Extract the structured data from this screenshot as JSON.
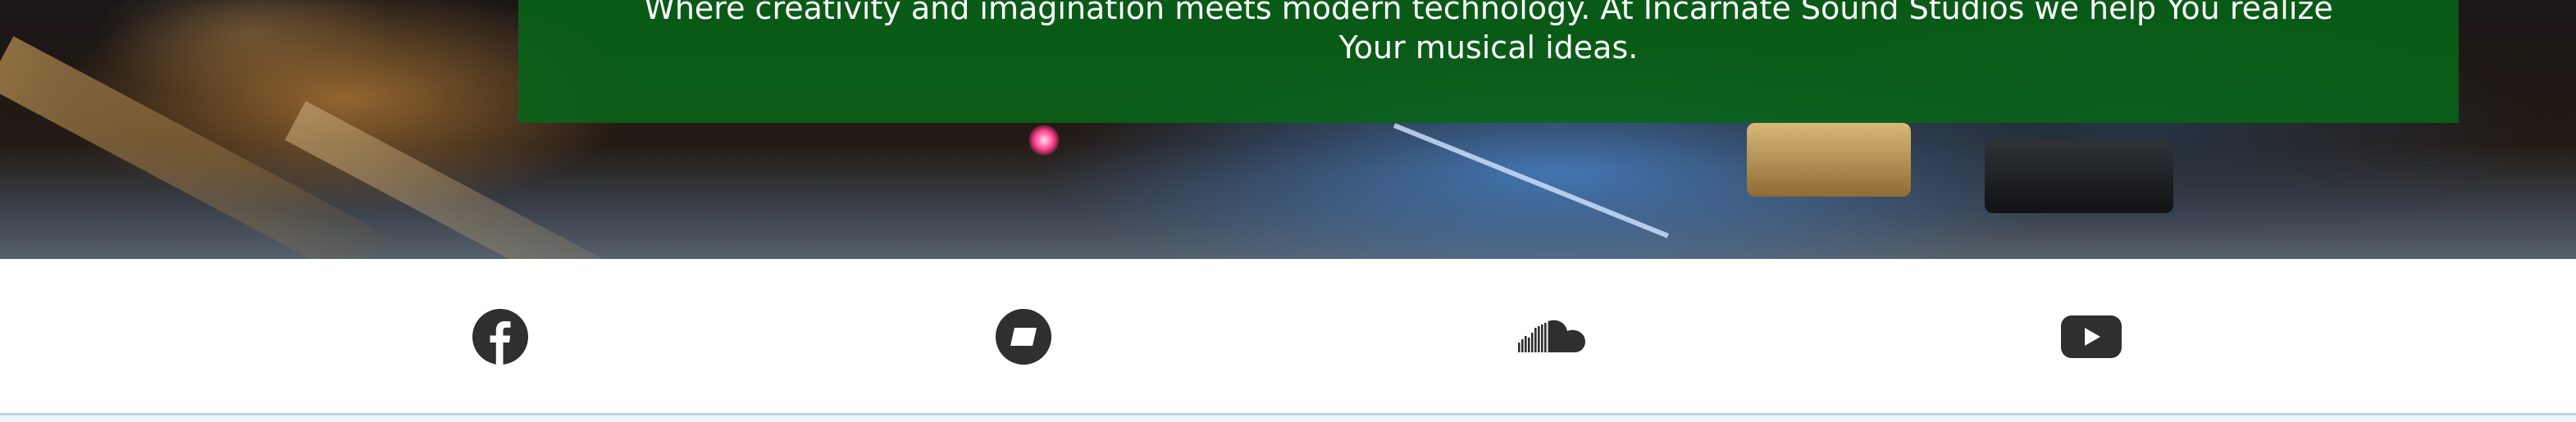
{
  "banner": {
    "line1": "Where creativity and imagination meets modern technology. At Incarnate Sound Studios we help You realize",
    "line2": "Your musical ideas."
  },
  "social": {
    "items": [
      {
        "name": "Facebook",
        "icon": "facebook-icon"
      },
      {
        "name": "Bandcamp",
        "icon": "bandcamp-icon"
      },
      {
        "name": "SoundCloud",
        "icon": "soundcloud-icon"
      },
      {
        "name": "YouTube",
        "icon": "youtube-icon"
      }
    ]
  },
  "colors": {
    "banner_green": "#086418",
    "icon_gray": "#2f2f2f",
    "divider_blue": "#b8d3de"
  }
}
